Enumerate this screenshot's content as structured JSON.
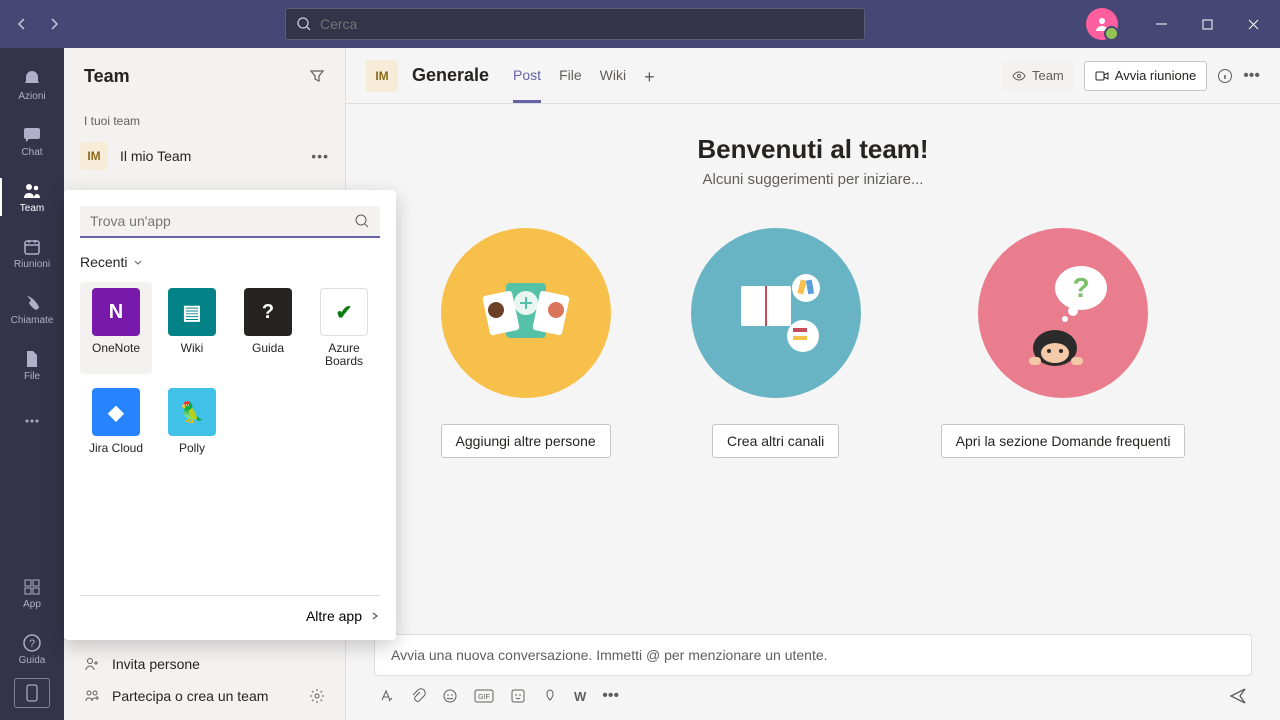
{
  "search": {
    "placeholder": "Cerca"
  },
  "rail": {
    "azioni": "Azioni",
    "chat": "Chat",
    "team": "Team",
    "riunioni": "Riunioni",
    "chiamate": "Chiamate",
    "file": "File",
    "app": "App",
    "guida": "Guida"
  },
  "sidebar": {
    "title": "Team",
    "your_teams": "I tuoi team",
    "team_initials": "IM",
    "team_name": "Il mio Team",
    "invite": "Invita persone",
    "join_create": "Partecipa o crea un team"
  },
  "popup": {
    "search_placeholder": "Trova un'app",
    "recenti": "Recenti",
    "apps": [
      {
        "label": "OneNote",
        "bg": "#7719aa",
        "glyph": "N"
      },
      {
        "label": "Wiki",
        "bg": "#038387",
        "glyph": "▤"
      },
      {
        "label": "Guida",
        "bg": "#252423",
        "glyph": "?"
      },
      {
        "label": "Azure Boards",
        "bg": "#ffffff",
        "glyph": "✔",
        "fg": "#107c10",
        "border": "#e1dfdd"
      },
      {
        "label": "Jira Cloud",
        "bg": "#2684ff",
        "glyph": "◆"
      },
      {
        "label": "Polly",
        "bg": "#40c1e8",
        "glyph": "🦜"
      }
    ],
    "more": "Altre app"
  },
  "channel": {
    "initials": "IM",
    "name": "Generale",
    "tabs": {
      "post": "Post",
      "file": "File",
      "wiki": "Wiki"
    },
    "team_pill": "Team",
    "meet": "Avvia riunione"
  },
  "welcome": {
    "title": "Benvenuti al team!",
    "subtitle": "Alcuni suggerimenti per iniziare...",
    "btn1": "Aggiungi altre persone",
    "btn2": "Crea altri canali",
    "btn3": "Apri la sezione Domande frequenti"
  },
  "composer": {
    "placeholder": "Avvia una nuova conversazione. Immetti @ per menzionare un utente."
  }
}
